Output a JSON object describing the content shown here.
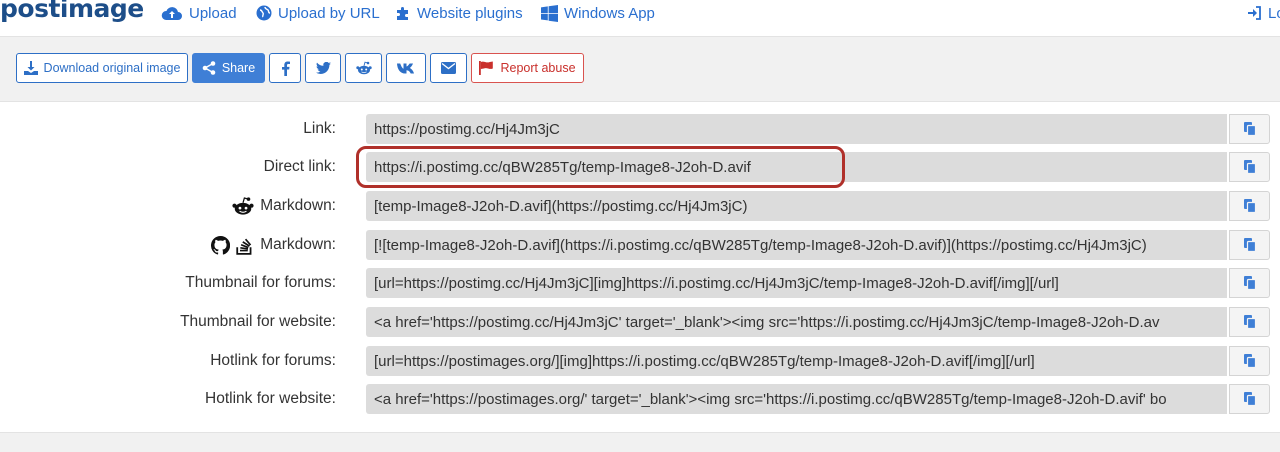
{
  "brand": {
    "logo": "postimage"
  },
  "nav": {
    "upload": "Upload",
    "upload_url": "Upload by URL",
    "plugins": "Website plugins",
    "windows": "Windows App",
    "login": "Lo"
  },
  "toolbar": {
    "download": "Download original image",
    "share": "Share",
    "report": "Report abuse"
  },
  "colors": {
    "accent": "#2d6fc6",
    "danger": "#c9302c",
    "highlight": "#b0302a"
  },
  "rows": [
    {
      "label": "Link:",
      "value": "https://postimg.cc/Hj4Jm3jC"
    },
    {
      "label": "Direct link:",
      "value": "https://i.postimg.cc/qBW285Tg/temp-Image8-J2oh-D.avif"
    },
    {
      "label": "Markdown:",
      "value": "[temp-Image8-J2oh-D.avif](https://postimg.cc/Hj4Jm3jC)"
    },
    {
      "label": "Markdown:",
      "value": "[![temp-Image8-J2oh-D.avif](https://i.postimg.cc/qBW285Tg/temp-Image8-J2oh-D.avif)](https://postimg.cc/Hj4Jm3jC)"
    },
    {
      "label": "Thumbnail for forums:",
      "value": "[url=https://postimg.cc/Hj4Jm3jC][img]https://i.postimg.cc/Hj4Jm3jC/temp-Image8-J2oh-D.avif[/img][/url]"
    },
    {
      "label": "Thumbnail for website:",
      "value": "<a href='https://postimg.cc/Hj4Jm3jC' target='_blank'><img src='https://i.postimg.cc/Hj4Jm3jC/temp-Image8-J2oh-D.av"
    },
    {
      "label": "Hotlink for forums:",
      "value": "[url=https://postimages.org/][img]https://i.postimg.cc/qBW285Tg/temp-Image8-J2oh-D.avif[/img][/url]"
    },
    {
      "label": "Hotlink for website:",
      "value": "<a href='https://postimages.org/' target='_blank'><img src='https://i.postimg.cc/qBW285Tg/temp-Image8-J2oh-D.avif' bo"
    }
  ]
}
